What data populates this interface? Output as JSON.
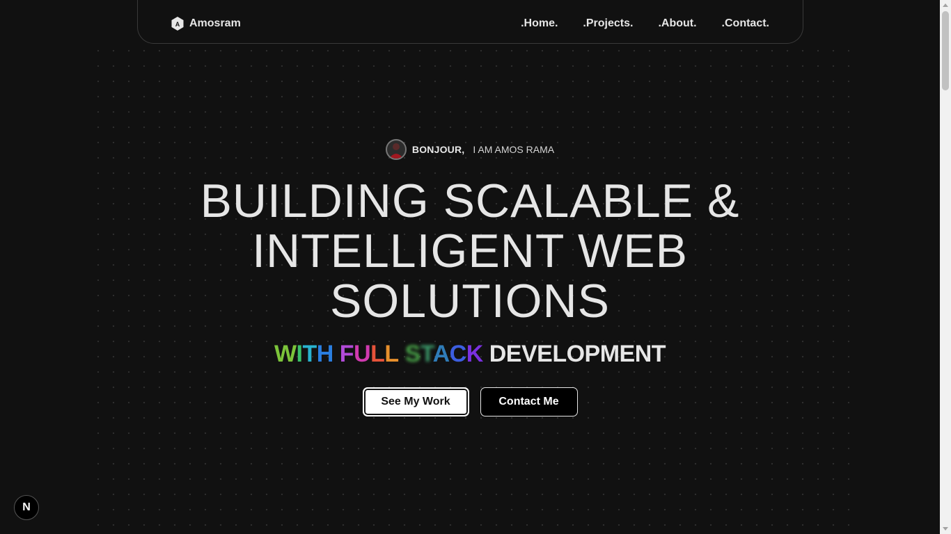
{
  "header": {
    "brand_name": "Amosram",
    "brand_icon": "hexagon-a-logo-icon",
    "nav": [
      ".Home.",
      ".Projects.",
      ".About.",
      ".Contact."
    ]
  },
  "hero": {
    "avatar_icon": "profile-avatar",
    "greeting": "BONJOUR,",
    "intro": "I AM AMOS RAMA",
    "headline_lines": [
      "BUILDING SCALABLE &",
      "INTELLIGENT WEB",
      "SOLUTIONS"
    ],
    "subline": {
      "word1": "WITH",
      "word2": "FULL",
      "word3": "STACK",
      "word4": "DEVELOPMENT"
    },
    "buttons": {
      "primary": "See My Work",
      "secondary": "Contact Me"
    }
  },
  "dev_badge": {
    "label": "N",
    "icon": "nextjs-dev-indicator-icon"
  },
  "colors": {
    "background": "#111111",
    "text": "#e6e6e6",
    "primary_button_bg": "#ffffff",
    "secondary_button_bg": "#000000"
  }
}
